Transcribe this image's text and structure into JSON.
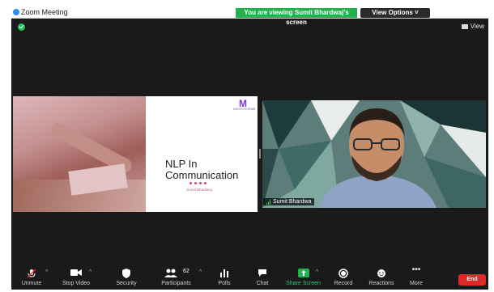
{
  "window": {
    "title": "Zoom Meeting",
    "share_banner": "You are viewing Sumit Bhardwaj's screen",
    "view_options": "View Options ˅",
    "view_label": "View"
  },
  "slide": {
    "brand": "INVOSYSTEMS",
    "title_line1": "NLP In",
    "title_line2": "Communication",
    "presenter": "Sumit Bhardwaj"
  },
  "video": {
    "participant_name": "Sumit Bhardwa"
  },
  "toolbar": {
    "unmute": "Unmute",
    "stop_video": "Stop Video",
    "security": "Security",
    "participants": "Participants",
    "participants_count": "62",
    "polls": "Polls",
    "chat": "Chat",
    "share_screen": "Share Screen",
    "record": "Record",
    "reactions": "Reactions",
    "more": "More",
    "end": "End"
  },
  "colors": {
    "share_banner": "#22b14c",
    "end_button": "#e02828",
    "accent_blue": "#2d8cff",
    "slide_accent": "#e03a7a"
  }
}
